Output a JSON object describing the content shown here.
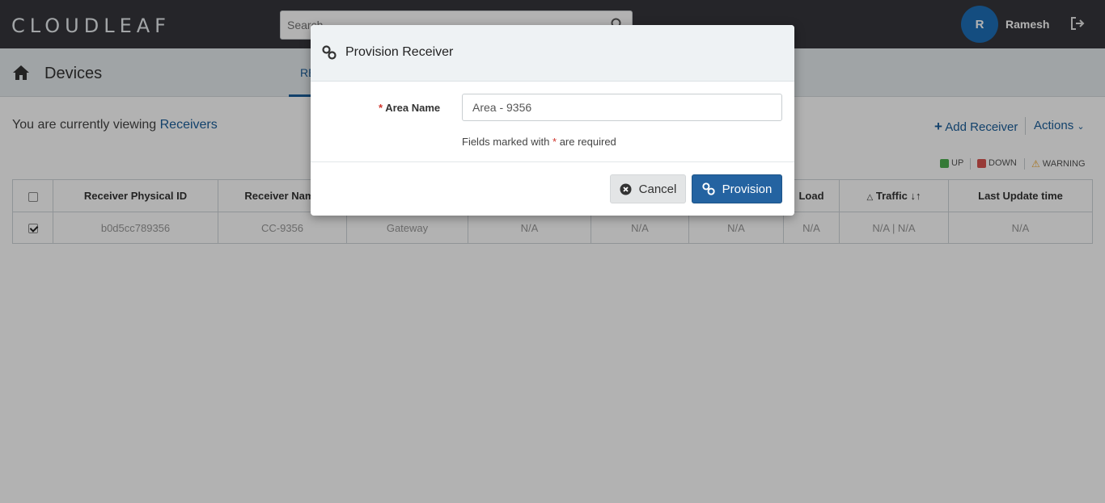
{
  "header": {
    "logo": "CLOUDLEAF",
    "search_placeholder": "Search",
    "avatar_initial": "R",
    "username": "Ramesh"
  },
  "subheader": {
    "title": "Devices",
    "active_tab": "RECEIVERS"
  },
  "main": {
    "viewing_prefix": "You are currently viewing",
    "viewing_entity": "Receivers",
    "add_button": "Add Receiver",
    "actions_menu": "Actions",
    "legend": [
      {
        "label": "UP",
        "color": "#4caf50"
      },
      {
        "label": "DOWN",
        "color": "#d9534f"
      },
      {
        "label": "WARNING",
        "color": "#f0a830",
        "icon": "warning-icon"
      }
    ]
  },
  "table": {
    "columns": [
      "",
      "Receiver Physical ID",
      "Receiver Name",
      "",
      "",
      "",
      "",
      "Load",
      "Traffic",
      "Last Update time"
    ],
    "rows": [
      {
        "checked": true,
        "cells": [
          "b0d5cc789356",
          "CC-9356",
          "Gateway",
          "N/A",
          "N/A",
          "N/A",
          "N/A",
          "N/A | N/A",
          "N/A"
        ]
      }
    ]
  },
  "modal": {
    "title": "Provision Receiver",
    "field_label": "Area Name",
    "required_mark": "*",
    "field_value": "Area - 9356",
    "hint_prefix": "Fields marked with",
    "hint_suffix": "are required",
    "cancel_label": "Cancel",
    "provision_label": "Provision"
  },
  "colors": {
    "topbar": "#35363b",
    "accent": "#1a5e9a",
    "primary_button": "#2463a1",
    "avatar": "#1d6fb8"
  }
}
